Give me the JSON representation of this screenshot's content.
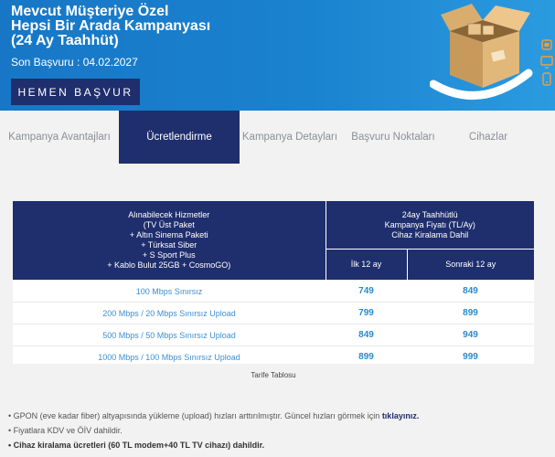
{
  "banner": {
    "title_lines": [
      "Mevcut Müşteriye Özel",
      "Hepsi Bir Arada Kampanyası",
      "(24 Ay Taahhüt)"
    ],
    "deadline": "Son Başvuru : 04.02.2027",
    "cta_label": "HEMEN BAŞVUR",
    "side_icons": [
      "internet",
      "tv",
      "phone"
    ]
  },
  "tabs": [
    {
      "label": "Kampanya Avantajları",
      "active": false
    },
    {
      "label": "Ücretlendirme",
      "active": true
    },
    {
      "label": "Kampanya Detayları",
      "active": false
    },
    {
      "label": "Başvuru Noktaları",
      "active": false
    },
    {
      "label": "Cihazlar",
      "active": false
    }
  ],
  "pricing_table": {
    "services_header": [
      "Alınabilecek Hizmetler",
      "(TV Üst Paket",
      "+ Altın Sinema Paketi",
      "+ Türksat Siber",
      "+ S Sport Plus",
      "+ Kablo Bulut 25GB + CosmoGO)"
    ],
    "campaign_header": [
      "24ay Taahhütlü",
      "Kampanya Fiyatı (TL/Ay)",
      "Cihaz Kiralama Dahil"
    ],
    "first_period": "İlk 12 ay",
    "next_period": "Sonraki 12 ay",
    "rows": [
      {
        "speed": "100 Mbps Sınırsız",
        "first": "749",
        "next": "849"
      },
      {
        "speed": "200 Mbps / 20 Mbps Sınırsız Upload",
        "first": "799",
        "next": "899"
      },
      {
        "speed": "500 Mbps / 50 Mbps Sınırsız Upload",
        "first": "849",
        "next": "949"
      },
      {
        "speed": "1000 Mbps / 100 Mbps Sınırsız Upload",
        "first": "899",
        "next": "999"
      }
    ],
    "caption": "Tarife Tablosu"
  },
  "notes": {
    "gpon_text": "GPON (eve kadar fiber) altyapısında yükleme (upload) hızları arttırılmıştır. Güncel hızları görmek için ",
    "gpon_link": "tıklayınız.",
    "tax_note": "Fiyatlara KDV ve ÖİV dahildir.",
    "rental_note": "Cihaz kiralama ücretleri (60 TL modem+40 TL TV cihazı) dahildir."
  },
  "colors": {
    "banner_blue": "#1a82cf",
    "navy": "#1f2e6d",
    "price_blue": "#2a8acb",
    "page_bg": "#f2f2f2"
  }
}
